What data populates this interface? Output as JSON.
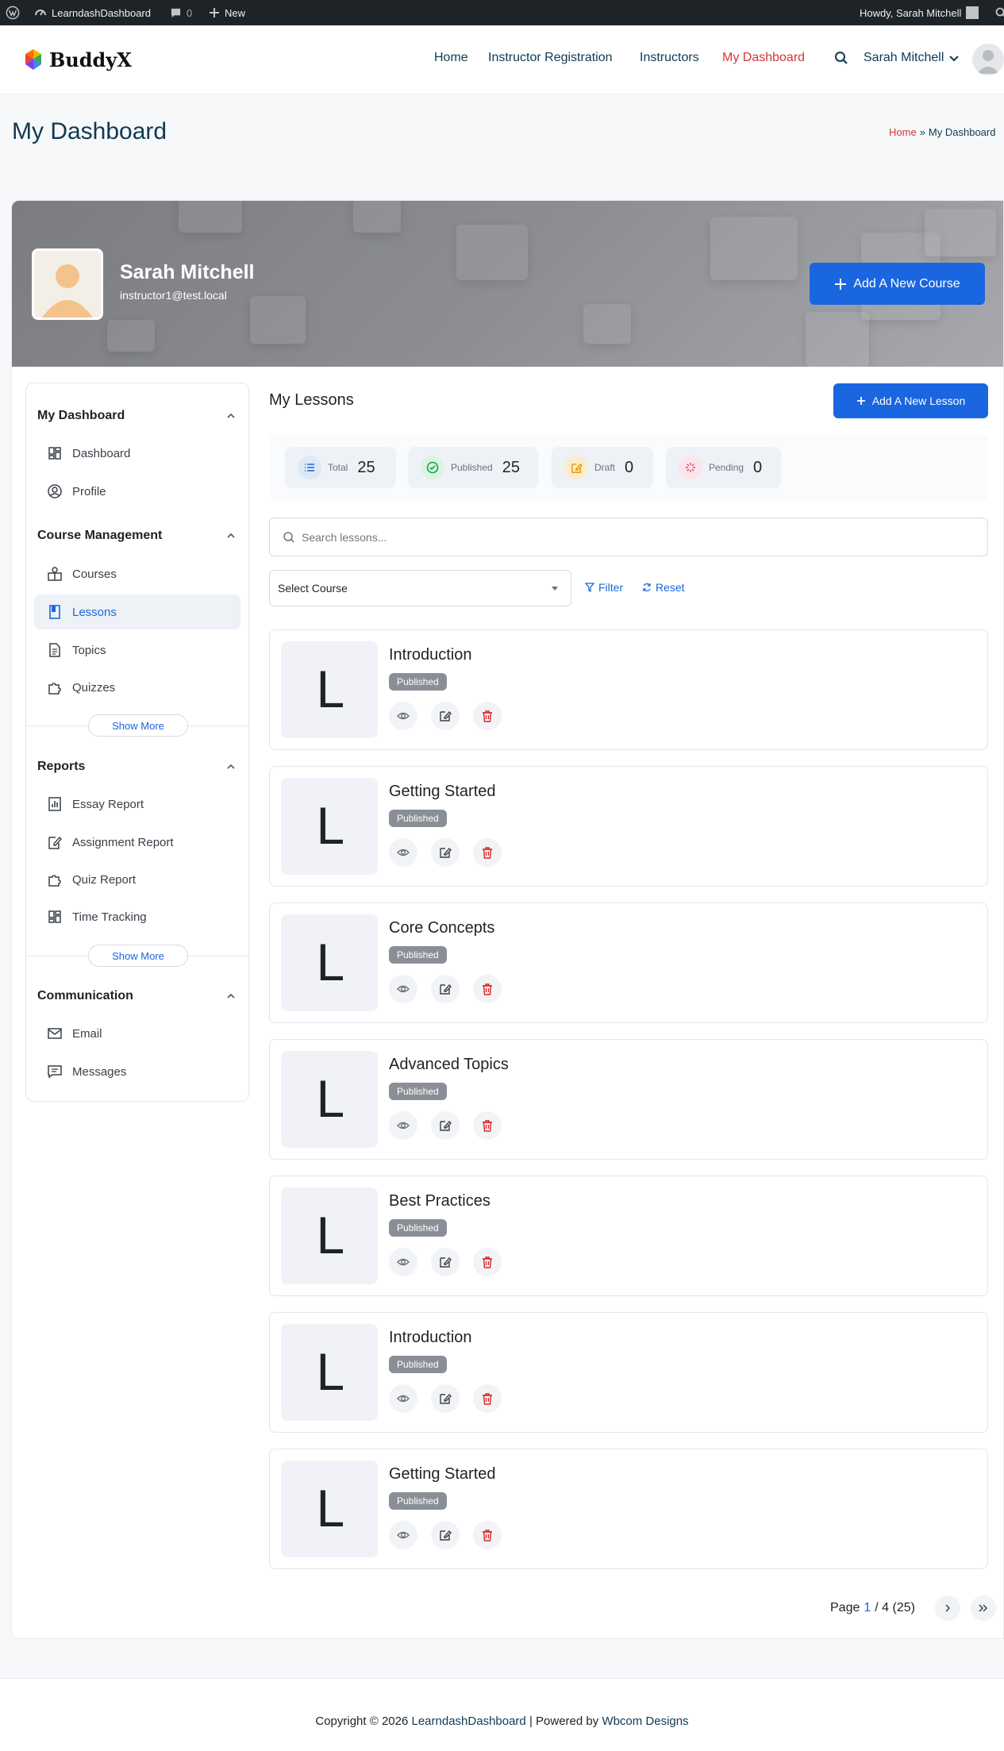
{
  "adminbar": {
    "site": "LearndashDashboard",
    "comments": "0",
    "new": "New",
    "howdy": "Howdy, Sarah Mitchell"
  },
  "header": {
    "logo": "BuddyX",
    "nav": [
      "Home",
      "Instructor Registration",
      "Instructors",
      "My Dashboard"
    ],
    "user": "Sarah Mitchell"
  },
  "page": {
    "title": "My Dashboard",
    "breadcrumb_home": "Home",
    "breadcrumb_sep": "»",
    "breadcrumb_current": "My Dashboard"
  },
  "profile": {
    "name": "Sarah Mitchell",
    "email": "instructor1@test.local",
    "add_course": "Add A New Course"
  },
  "sidebar": {
    "sections": [
      {
        "title": "My Dashboard",
        "items": [
          {
            "label": "Dashboard",
            "icon": "grid-icon"
          },
          {
            "label": "Profile",
            "icon": "user-circle-icon"
          }
        ]
      },
      {
        "title": "Course Management",
        "items": [
          {
            "label": "Courses",
            "icon": "courses-icon"
          },
          {
            "label": "Lessons",
            "icon": "book-icon",
            "active": true
          },
          {
            "label": "Topics",
            "icon": "document-icon"
          },
          {
            "label": "Quizzes",
            "icon": "puzzle-icon"
          }
        ],
        "show_more": "Show More"
      },
      {
        "title": "Reports",
        "items": [
          {
            "label": "Essay Report",
            "icon": "bar-chart-icon"
          },
          {
            "label": "Assignment Report",
            "icon": "assignment-icon"
          },
          {
            "label": "Quiz Report",
            "icon": "puzzle-icon"
          },
          {
            "label": "Time Tracking",
            "icon": "grid-icon"
          }
        ],
        "show_more": "Show More"
      },
      {
        "title": "Communication",
        "items": [
          {
            "label": "Email",
            "icon": "mail-icon"
          },
          {
            "label": "Messages",
            "icon": "message-icon"
          }
        ]
      }
    ]
  },
  "lessons": {
    "title": "My Lessons",
    "add_lesson": "Add A New Lesson",
    "stats": [
      {
        "label": "Total",
        "value": "25"
      },
      {
        "label": "Published",
        "value": "25"
      },
      {
        "label": "Draft",
        "value": "0"
      },
      {
        "label": "Pending",
        "value": "0"
      }
    ],
    "search_placeholder": "Search lessons...",
    "select_course": "Select Course",
    "filter": "Filter",
    "reset": "Reset",
    "items": [
      {
        "initial": "L",
        "title": "Introduction",
        "status": "Published"
      },
      {
        "initial": "L",
        "title": "Getting Started",
        "status": "Published"
      },
      {
        "initial": "L",
        "title": "Core Concepts",
        "status": "Published"
      },
      {
        "initial": "L",
        "title": "Advanced Topics",
        "status": "Published"
      },
      {
        "initial": "L",
        "title": "Best Practices",
        "status": "Published"
      },
      {
        "initial": "L",
        "title": "Introduction",
        "status": "Published"
      },
      {
        "initial": "L",
        "title": "Getting Started",
        "status": "Published"
      }
    ],
    "pagination": {
      "prefix": "Page",
      "current": "1",
      "rest": "/ 4 (25)"
    }
  },
  "footer": {
    "prefix": "Copyright © 2026",
    "site": "LearndashDashboard",
    "powered": "| Powered by",
    "company": "Wbcom Designs"
  },
  "colors": {
    "accent": "#1a66e0",
    "brand_red": "#d63638",
    "nav_text": "#0f3a52"
  }
}
